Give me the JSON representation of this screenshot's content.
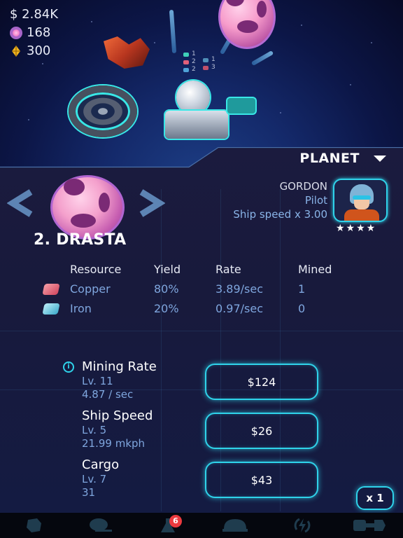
{
  "currencies": {
    "cash": "$ 2.84K",
    "gems": "168",
    "fuel": "300"
  },
  "scene": {
    "mined_counts_left": [
      "1",
      "2",
      "2"
    ],
    "mined_counts_right": [
      "1",
      "3"
    ]
  },
  "panel": {
    "dropdown_label": "PLANET",
    "planet": {
      "name": "2. DRASTA"
    },
    "pilot": {
      "name": "GORDON",
      "role": "Pilot",
      "bonus": "Ship speed x 3.00",
      "stars": "★★★★",
      "star_count": 4
    },
    "resources": {
      "headers": [
        "Resource",
        "Yield",
        "Rate",
        "Mined"
      ],
      "rows": [
        {
          "resource": "Copper",
          "yield": "80%",
          "rate": "3.89/sec",
          "mined": "1",
          "color": "#e0607a"
        },
        {
          "resource": "Iron",
          "yield": "20%",
          "rate": "0.97/sec",
          "mined": "0",
          "color": "#4fc3e0"
        }
      ]
    },
    "upgrades": [
      {
        "title": "Mining Rate",
        "level": "Lv. 11",
        "value": "4.87 / sec",
        "price": "$124"
      },
      {
        "title": "Ship Speed",
        "level": "Lv. 5",
        "value": "21.99 mkph",
        "price": "$26"
      },
      {
        "title": "Cargo",
        "level": "Lv. 7",
        "value": "31",
        "price": "$43"
      }
    ],
    "multiplier": "x 1",
    "info_icon": "i"
  },
  "bottom_nav": {
    "items": [
      {
        "icon": "planet-icon"
      },
      {
        "icon": "chat-icon"
      },
      {
        "icon": "lab-flask-icon",
        "badge": "6"
      },
      {
        "icon": "dome-icon"
      },
      {
        "icon": "lightning-boost-icon"
      },
      {
        "icon": "shop-icon"
      }
    ]
  },
  "colors": {
    "accent": "#2fd3ea",
    "label_blue": "#7fa6de",
    "badge_red": "#ec3a3f"
  }
}
